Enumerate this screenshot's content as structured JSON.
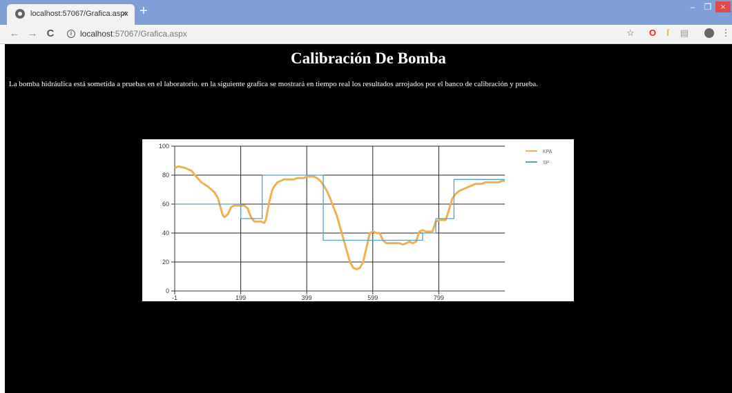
{
  "browser": {
    "tab_title": "localhost:57067/Grafica.aspx",
    "url_host": "localhost",
    "url_path": ":57067/Grafica.aspx"
  },
  "page": {
    "title": "Calibración De Bomba",
    "description": "La bomba hidráulica está sometida a pruebas en el laboratorio. en la siguiente grafica se mostrará en tiempo real los resultados arrojados por el banco de calibración y prueba."
  },
  "colors": {
    "kpa": "#f0b050",
    "sp": "#5a9ec0",
    "background": "#000000"
  },
  "chart_data": {
    "type": "line",
    "x_ticks": [
      -1,
      199,
      399,
      599,
      799
    ],
    "y_ticks": [
      0,
      20,
      40,
      60,
      80,
      100
    ],
    "xlim": [
      -1,
      999
    ],
    "ylim": [
      0,
      100
    ],
    "grid": true,
    "legend_position": "top-right",
    "series": [
      {
        "name": "KPA",
        "x": [
          -1,
          10,
          30,
          50,
          60,
          80,
          100,
          120,
          130,
          135,
          140,
          145,
          150,
          160,
          170,
          180,
          190,
          200,
          210,
          220,
          230,
          240,
          250,
          260,
          270,
          275,
          280,
          285,
          290,
          295,
          300,
          310,
          320,
          330,
          340,
          350,
          360,
          370,
          380,
          390,
          400,
          410,
          420,
          430,
          440,
          450,
          460,
          470,
          480,
          490,
          500,
          510,
          520,
          530,
          540,
          550,
          560,
          570,
          580,
          590,
          600,
          610,
          620,
          630,
          640,
          650,
          660,
          670,
          680,
          690,
          700,
          710,
          720,
          730,
          740,
          750,
          760,
          770,
          780,
          790,
          800,
          810,
          820,
          830,
          840,
          850,
          860,
          870,
          880,
          890,
          900,
          910,
          920,
          930,
          940,
          950,
          960,
          970,
          980,
          990,
          999
        ],
        "y": [
          85,
          86,
          85,
          83,
          80,
          75,
          72,
          68,
          64,
          60,
          56,
          52,
          51,
          53,
          58,
          59,
          59,
          59,
          59,
          57,
          51,
          48,
          48,
          48,
          47,
          49,
          55,
          61,
          66,
          70,
          72,
          75,
          76,
          77,
          77,
          77,
          77,
          78,
          78,
          78,
          79,
          79,
          79,
          78,
          76,
          73,
          69,
          64,
          58,
          52,
          44,
          36,
          28,
          20,
          16,
          15,
          16,
          20,
          30,
          40,
          41,
          40,
          40,
          35,
          33,
          33,
          33,
          33,
          33,
          32,
          33,
          34,
          33,
          34,
          41,
          42,
          41,
          41,
          41,
          48,
          49,
          49,
          49,
          56,
          64,
          67,
          69,
          70,
          71,
          72,
          73,
          74,
          74,
          74,
          75,
          75,
          75,
          75,
          75,
          76,
          76
        ]
      },
      {
        "name": "SP",
        "x": [
          -1,
          199,
          199,
          264,
          264,
          449,
          449,
          750,
          750,
          790,
          790,
          845,
          845,
          999
        ],
        "y": [
          60,
          60,
          50,
          50,
          80,
          80,
          35,
          35,
          40,
          40,
          50,
          50,
          77,
          77
        ]
      }
    ]
  }
}
